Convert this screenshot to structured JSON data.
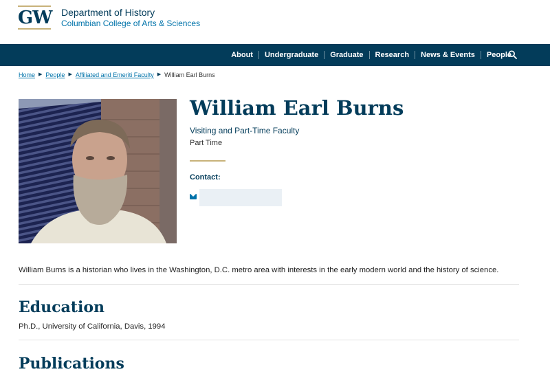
{
  "header": {
    "logo_text": "GW",
    "department": "Department of History",
    "college": "Columbian College of Arts & Sciences"
  },
  "nav": {
    "items": [
      {
        "label": "About"
      },
      {
        "label": "Undergraduate"
      },
      {
        "label": "Graduate"
      },
      {
        "label": "Research"
      },
      {
        "label": "News & Events"
      },
      {
        "label": "People"
      }
    ],
    "search_icon": "search-icon"
  },
  "breadcrumb": {
    "items": [
      {
        "label": "Home"
      },
      {
        "label": "People"
      },
      {
        "label": "Affiliated and Emeriti Faculty"
      }
    ],
    "current": "William Earl Burns"
  },
  "profile": {
    "name": "William Earl Burns",
    "title": "Visiting and Part-Time Faculty",
    "status": "Part Time",
    "contact_label": "Contact:",
    "email_icon": "envelope-icon",
    "bio": "William Burns is a historian who lives in the Washington, D.C. metro area with interests in the early modern world and the history of science."
  },
  "sections": {
    "education_heading": "Education",
    "education_items": [
      "Ph.D., University of California, Davis, 1994"
    ],
    "publications_heading": "Publications"
  },
  "colors": {
    "brand_navy": "#033c5a",
    "link_blue": "#0073aa",
    "gold": "#c8b27a"
  }
}
